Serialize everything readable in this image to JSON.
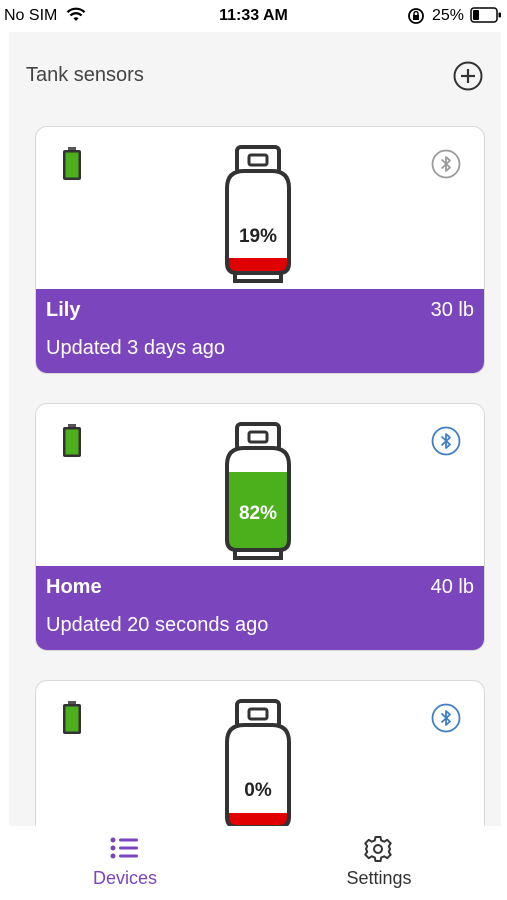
{
  "status_bar": {
    "carrier": "No SIM",
    "time": "11:33 AM",
    "battery_percent": "25%"
  },
  "header": {
    "title": "Tank sensors",
    "add_icon": "plus-circle-icon"
  },
  "devices": [
    {
      "name": "Lily",
      "size": "30 lb",
      "updated": "Updated 3 days ago",
      "level_percent": "19%",
      "level_fraction": 0.19,
      "fill_color": "#e00000",
      "bluetooth_color": "#9a9a9a"
    },
    {
      "name": "Home",
      "size": "40 lb",
      "updated": "Updated 20 seconds ago",
      "level_percent": "82%",
      "level_fraction": 0.82,
      "fill_color": "#4caf1c",
      "bluetooth_color": "#3f7fc7"
    },
    {
      "name": "",
      "size": "",
      "updated": "",
      "level_percent": "0%",
      "level_fraction": 0.0,
      "fill_color": "#e00000",
      "bluetooth_color": "#3f7fc7"
    }
  ],
  "nav": {
    "devices_label": "Devices",
    "settings_label": "Settings"
  },
  "colors": {
    "accent": "#7a45bd",
    "battery_green": "#4caf1c"
  }
}
